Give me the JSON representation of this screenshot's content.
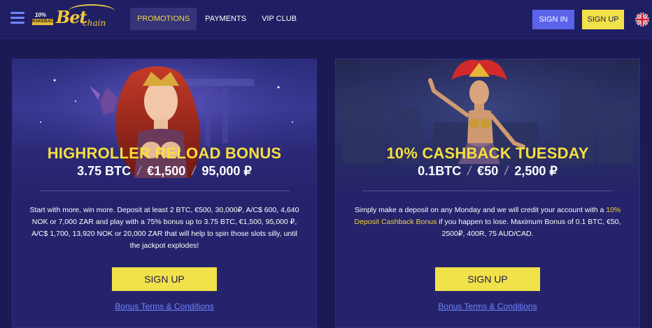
{
  "header": {
    "menu_icon": "hamburger-icon",
    "logo": {
      "badge_top": "10%",
      "badge_ribbon": "RAKEBACK",
      "brand": "Bet",
      "brand_sub": "chain"
    },
    "nav": [
      {
        "label": "PROMOTIONS",
        "active": true
      },
      {
        "label": "PAYMENTS",
        "active": false
      },
      {
        "label": "VIP CLUB",
        "active": false
      }
    ],
    "signin_label": "SIGN IN",
    "signup_label": "SIGN UP",
    "language_icon": "uk-flag-icon"
  },
  "promotions": [
    {
      "title": "HIGHROLLER RELOAD BONUS",
      "amounts": [
        "3.75 BTC",
        "€1,500",
        "95,000 ₽"
      ],
      "separator": "/",
      "description": "Start with more, win more. Deposit at least 2 BTC, €500, 30,000₽, A/C$ 600, 4,640 NOK or 7,000 ZAR and play with a 75% bonus up to 3.75 BTC, €1,500, 95,000 ₽, A/C$ 1,700, 13,920 NOK or 20,000 ZAR that will help to spin those slots silly, until the jackpot explodes!",
      "signup_label": "SIGN UP",
      "terms_label": "Bonus Terms & Conditions"
    },
    {
      "title": "10% CASHBACK TUESDAY",
      "amounts": [
        "0.1BTC",
        "€50",
        "2,500 ₽"
      ],
      "separator": "/",
      "description_before": "Simply make a deposit on any Monday and we will credit your account with a ",
      "description_highlight": "10% Deposit Cashback Bonus",
      "description_after": " if you happen to lose. Maximum Bonus of 0.1 BTC, €50, 2500₽, 400R, 75 AUD/CAD.",
      "signup_label": "SIGN UP",
      "terms_label": "Bonus Terms & Conditions"
    }
  ],
  "colors": {
    "background": "#1c1a55",
    "card": "#25236b",
    "accent_yellow": "#f2e24a",
    "title_yellow": "#f6df3e",
    "signin_blue": "#5b63ea",
    "link_blue": "#6f86ff"
  }
}
